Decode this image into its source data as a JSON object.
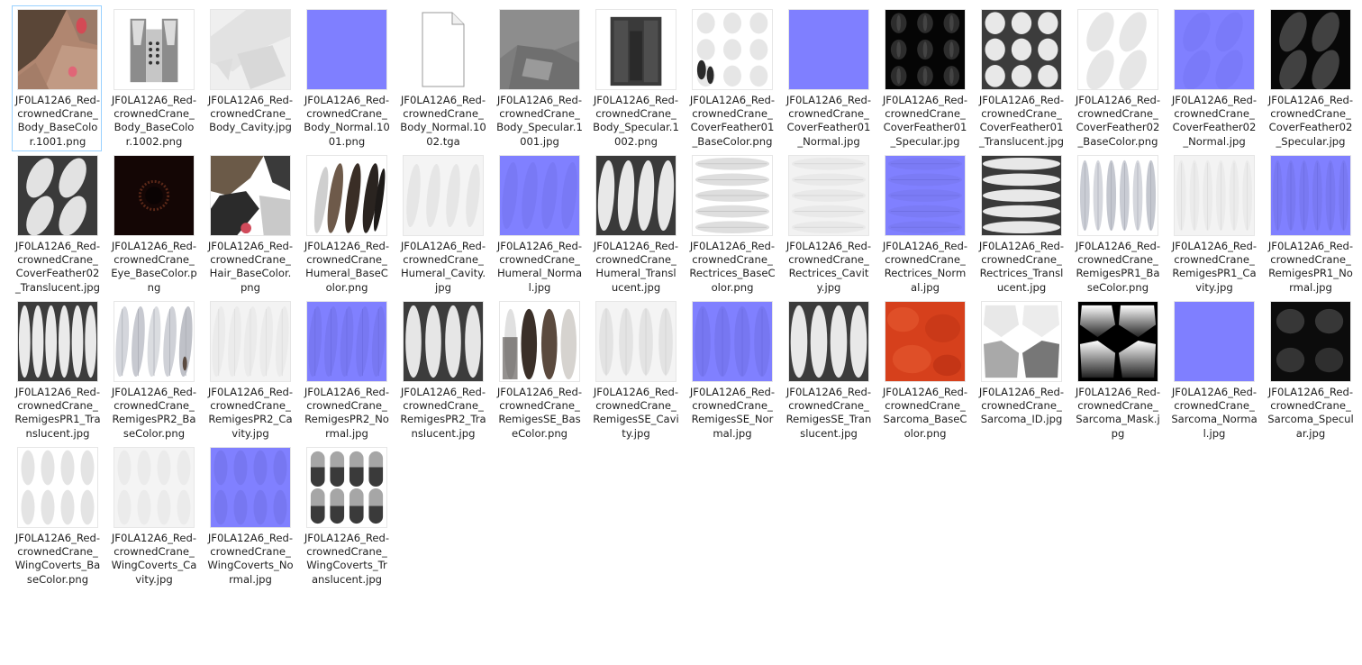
{
  "explorer": {
    "view": "large-icons",
    "selected_index": 0
  },
  "files": [
    {
      "name": "JF0LA12A6_Red-crownedCrane_Body_BaseColor.1001.png",
      "thumb": "body-base1"
    },
    {
      "name": "JF0LA12A6_Red-crownedCrane_Body_BaseColor.1002.png",
      "thumb": "body-base2"
    },
    {
      "name": "JF0LA12A6_Red-crownedCrane_Body_Cavity.jpg",
      "thumb": "body-cavity"
    },
    {
      "name": "JF0LA12A6_Red-crownedCrane_Body_Normal.1001.png",
      "thumb": "normal-plain"
    },
    {
      "name": "JF0LA12A6_Red-crownedCrane_Body_Normal.1002.tga",
      "thumb": "blank-file-icon"
    },
    {
      "name": "JF0LA12A6_Red-crownedCrane_Body_Specular.1001.jpg",
      "thumb": "body-spec1"
    },
    {
      "name": "JF0LA12A6_Red-crownedCrane_Body_Specular.1002.png",
      "thumb": "body-spec2"
    },
    {
      "name": "JF0LA12A6_Red-crownedCrane_CoverFeather01_BaseColor.png",
      "thumb": "cf01-base"
    },
    {
      "name": "JF0LA12A6_Red-crownedCrane_CoverFeather01_Normal.jpg",
      "thumb": "normal-plain"
    },
    {
      "name": "JF0LA12A6_Red-crownedCrane_CoverFeather01_Specular.jpg",
      "thumb": "cf01-spec"
    },
    {
      "name": "JF0LA12A6_Red-crownedCrane_CoverFeather01_Translucent.jpg",
      "thumb": "cf01-trans"
    },
    {
      "name": "JF0LA12A6_Red-crownedCrane_CoverFeather02_BaseColor.png",
      "thumb": "cf02-base"
    },
    {
      "name": "JF0LA12A6_Red-crownedCrane_CoverFeather02_Normal.jpg",
      "thumb": "cf02-normal"
    },
    {
      "name": "JF0LA12A6_Red-crownedCrane_CoverFeather02_Specular.jpg",
      "thumb": "cf02-spec"
    },
    {
      "name": "JF0LA12A6_Red-crownedCrane_CoverFeather02_Translucent.jpg",
      "thumb": "cf02-trans"
    },
    {
      "name": "JF0LA12A6_Red-crownedCrane_Eye_BaseColor.png",
      "thumb": "eye-base"
    },
    {
      "name": "JF0LA12A6_Red-crownedCrane_Hair_BaseColor.png",
      "thumb": "hair-base"
    },
    {
      "name": "JF0LA12A6_Red-crownedCrane_Humeral_BaseColor.png",
      "thumb": "humeral-base"
    },
    {
      "name": "JF0LA12A6_Red-crownedCrane_Humeral_Cavity.jpg",
      "thumb": "humeral-cavity"
    },
    {
      "name": "JF0LA12A6_Red-crownedCrane_Humeral_Normal.jpg",
      "thumb": "humeral-normal"
    },
    {
      "name": "JF0LA12A6_Red-crownedCrane_Humeral_Translucent.jpg",
      "thumb": "humeral-trans"
    },
    {
      "name": "JF0LA12A6_Red-crownedCrane_Rectrices_BaseColor.png",
      "thumb": "rect-base"
    },
    {
      "name": "JF0LA12A6_Red-crownedCrane_Rectrices_Cavity.jpg",
      "thumb": "rect-cavity"
    },
    {
      "name": "JF0LA12A6_Red-crownedCrane_Rectrices_Normal.jpg",
      "thumb": "rect-normal"
    },
    {
      "name": "JF0LA12A6_Red-crownedCrane_Rectrices_Translucent.jpg",
      "thumb": "rect-trans"
    },
    {
      "name": "JF0LA12A6_Red-crownedCrane_RemigesPR1_BaseColor.png",
      "thumb": "pr1-base"
    },
    {
      "name": "JF0LA12A6_Red-crownedCrane_RemigesPR1_Cavity.jpg",
      "thumb": "pr1-cavity"
    },
    {
      "name": "JF0LA12A6_Red-crownedCrane_RemigesPR1_Normal.jpg",
      "thumb": "pr1-normal"
    },
    {
      "name": "JF0LA12A6_Red-crownedCrane_RemigesPR1_Translucent.jpg",
      "thumb": "pr1-trans"
    },
    {
      "name": "JF0LA12A6_Red-crownedCrane_RemigesPR2_BaseColor.png",
      "thumb": "pr2-base"
    },
    {
      "name": "JF0LA12A6_Red-crownedCrane_RemigesPR2_Cavity.jpg",
      "thumb": "pr2-cavity"
    },
    {
      "name": "JF0LA12A6_Red-crownedCrane_RemigesPR2_Normal.jpg",
      "thumb": "pr2-normal"
    },
    {
      "name": "JF0LA12A6_Red-crownedCrane_RemigesPR2_Translucent.jpg",
      "thumb": "pr2-trans"
    },
    {
      "name": "JF0LA12A6_Red-crownedCrane_RemigesSE_BaseColor.png",
      "thumb": "se-base"
    },
    {
      "name": "JF0LA12A6_Red-crownedCrane_RemigesSE_Cavity.jpg",
      "thumb": "se-cavity"
    },
    {
      "name": "JF0LA12A6_Red-crownedCrane_RemigesSE_Normal.jpg",
      "thumb": "se-normal"
    },
    {
      "name": "JF0LA12A6_Red-crownedCrane_RemigesSE_Translucent.jpg",
      "thumb": "se-trans"
    },
    {
      "name": "JF0LA12A6_Red-crownedCrane_Sarcoma_BaseColor.png",
      "thumb": "sarcoma-base"
    },
    {
      "name": "JF0LA12A6_Red-crownedCrane_Sarcoma_ID.jpg",
      "thumb": "sarcoma-id"
    },
    {
      "name": "JF0LA12A6_Red-crownedCrane_Sarcoma_Mask.jpg",
      "thumb": "sarcoma-mask"
    },
    {
      "name": "JF0LA12A6_Red-crownedCrane_Sarcoma_Normal.jpg",
      "thumb": "normal-plain"
    },
    {
      "name": "JF0LA12A6_Red-crownedCrane_Sarcoma_Specular.jpg",
      "thumb": "sarcoma-spec"
    },
    {
      "name": "JF0LA12A6_Red-crownedCrane_WingCoverts_BaseColor.png",
      "thumb": "wc-base"
    },
    {
      "name": "JF0LA12A6_Red-crownedCrane_WingCoverts_Cavity.jpg",
      "thumb": "wc-cavity"
    },
    {
      "name": "JF0LA12A6_Red-crownedCrane_WingCoverts_Normal.jpg",
      "thumb": "wc-normal"
    },
    {
      "name": "JF0LA12A6_Red-crownedCrane_WingCoverts_Translucent.jpg",
      "thumb": "wc-trans"
    }
  ],
  "colors": {
    "normal_map": "#8080ff",
    "selection_border": "#99d1ff",
    "text": "#1e1e1e"
  }
}
